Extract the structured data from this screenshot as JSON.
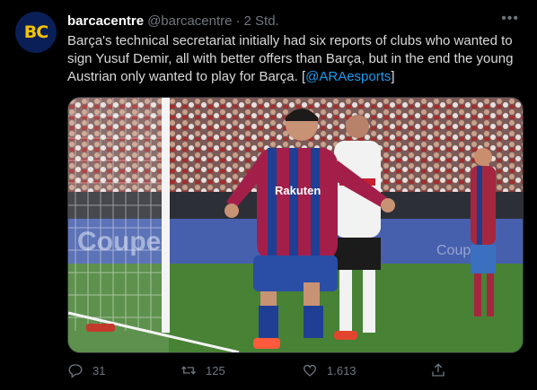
{
  "tweet": {
    "avatar_text": "BC",
    "display_name": "barcacentre",
    "handle": "@barcacentre",
    "separator": "·",
    "time": "2 Std.",
    "text_before": "Barça's technical secretariat initially had six reports of clubs who wanted to sign Yusuf Demir, all with better offers than Barça, but in the end the young Austrian only wanted to play for Barça. [",
    "mention": "@ARAesports",
    "text_after": "]",
    "more_icon": "more-horizontal-icon",
    "media": {
      "sponsor_text": "Rakuten",
      "board_text": "Coupe",
      "board_text_2": "Coupe"
    },
    "actions": {
      "reply_count": "31",
      "retweet_count": "125",
      "like_count": "1.613"
    }
  },
  "colors": {
    "background": "#000000",
    "text": "#d9d9d9",
    "secondary": "#6e767d",
    "link": "#1d9bf0",
    "avatar_bg": "#0b1f57",
    "avatar_fg": "#f2c300"
  }
}
